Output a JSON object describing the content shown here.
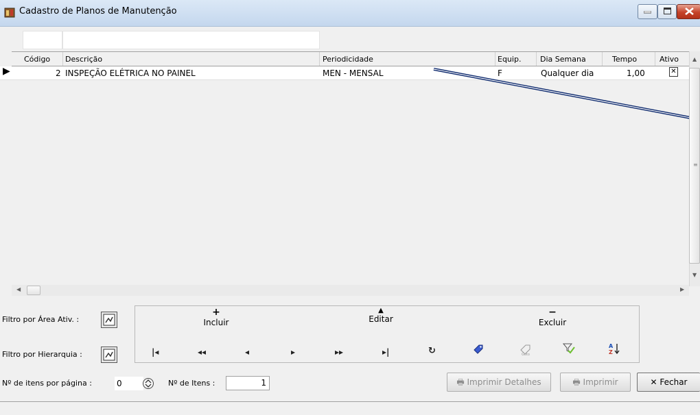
{
  "window": {
    "title": "Cadastro de Planos de Manutenção"
  },
  "grid": {
    "columns": [
      "Código",
      "Descrição",
      "Periodicidade",
      "Equip.",
      "Dia Semana",
      "Tempo",
      "Ativo"
    ],
    "rows": [
      {
        "codigo": "2",
        "descricao": "INSPEÇÃO ELÉTRICA NO PAINEL",
        "periodicidade": "MEN - MENSAL",
        "equip": "F",
        "dia_semana": "Qualquer dia",
        "tempo": "1,00",
        "ativo": "✕"
      }
    ]
  },
  "filters": {
    "area_label": "Filtro por Área Ativ. :",
    "hierarquia_label": "Filtro por Hierarquia :"
  },
  "actions": {
    "incluir": "Incluir",
    "editar": "Editar",
    "excluir": "Excluir"
  },
  "paging": {
    "itens_por_pagina_label": "Nº de itens por página :",
    "itens_por_pagina_value": "0",
    "n_itens_label": "Nº de Itens :",
    "n_itens_value": "1"
  },
  "buttons": {
    "imprimir_detalhes": "Imprimir Detalhes",
    "imprimir": "Imprimir",
    "fechar": "Fechar"
  },
  "icons": [
    "app-icon",
    "minimize-icon",
    "maximize-icon",
    "close-icon",
    "first-icon",
    "prev-page-icon",
    "prev-icon",
    "next-icon",
    "next-page-icon",
    "last-icon",
    "refresh-icon",
    "tag-icon",
    "goto-icon",
    "filter-icon",
    "sort-az-icon",
    "printer-icon",
    "spin-icon"
  ]
}
